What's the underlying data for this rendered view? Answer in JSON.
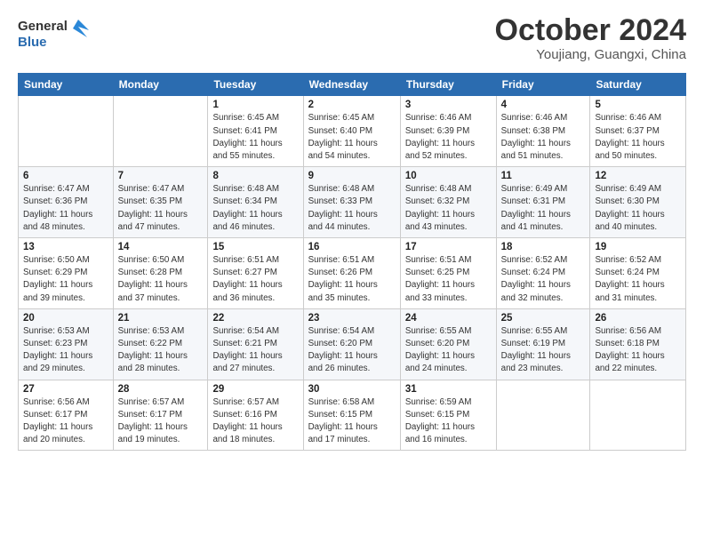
{
  "header": {
    "logo_line1": "General",
    "logo_line2": "Blue",
    "month": "October 2024",
    "location": "Youjiang, Guangxi, China"
  },
  "weekdays": [
    "Sunday",
    "Monday",
    "Tuesday",
    "Wednesday",
    "Thursday",
    "Friday",
    "Saturday"
  ],
  "weeks": [
    [
      {
        "day": "",
        "info": ""
      },
      {
        "day": "",
        "info": ""
      },
      {
        "day": "1",
        "info": "Sunrise: 6:45 AM\nSunset: 6:41 PM\nDaylight: 11 hours\nand 55 minutes."
      },
      {
        "day": "2",
        "info": "Sunrise: 6:45 AM\nSunset: 6:40 PM\nDaylight: 11 hours\nand 54 minutes."
      },
      {
        "day": "3",
        "info": "Sunrise: 6:46 AM\nSunset: 6:39 PM\nDaylight: 11 hours\nand 52 minutes."
      },
      {
        "day": "4",
        "info": "Sunrise: 6:46 AM\nSunset: 6:38 PM\nDaylight: 11 hours\nand 51 minutes."
      },
      {
        "day": "5",
        "info": "Sunrise: 6:46 AM\nSunset: 6:37 PM\nDaylight: 11 hours\nand 50 minutes."
      }
    ],
    [
      {
        "day": "6",
        "info": "Sunrise: 6:47 AM\nSunset: 6:36 PM\nDaylight: 11 hours\nand 48 minutes."
      },
      {
        "day": "7",
        "info": "Sunrise: 6:47 AM\nSunset: 6:35 PM\nDaylight: 11 hours\nand 47 minutes."
      },
      {
        "day": "8",
        "info": "Sunrise: 6:48 AM\nSunset: 6:34 PM\nDaylight: 11 hours\nand 46 minutes."
      },
      {
        "day": "9",
        "info": "Sunrise: 6:48 AM\nSunset: 6:33 PM\nDaylight: 11 hours\nand 44 minutes."
      },
      {
        "day": "10",
        "info": "Sunrise: 6:48 AM\nSunset: 6:32 PM\nDaylight: 11 hours\nand 43 minutes."
      },
      {
        "day": "11",
        "info": "Sunrise: 6:49 AM\nSunset: 6:31 PM\nDaylight: 11 hours\nand 41 minutes."
      },
      {
        "day": "12",
        "info": "Sunrise: 6:49 AM\nSunset: 6:30 PM\nDaylight: 11 hours\nand 40 minutes."
      }
    ],
    [
      {
        "day": "13",
        "info": "Sunrise: 6:50 AM\nSunset: 6:29 PM\nDaylight: 11 hours\nand 39 minutes."
      },
      {
        "day": "14",
        "info": "Sunrise: 6:50 AM\nSunset: 6:28 PM\nDaylight: 11 hours\nand 37 minutes."
      },
      {
        "day": "15",
        "info": "Sunrise: 6:51 AM\nSunset: 6:27 PM\nDaylight: 11 hours\nand 36 minutes."
      },
      {
        "day": "16",
        "info": "Sunrise: 6:51 AM\nSunset: 6:26 PM\nDaylight: 11 hours\nand 35 minutes."
      },
      {
        "day": "17",
        "info": "Sunrise: 6:51 AM\nSunset: 6:25 PM\nDaylight: 11 hours\nand 33 minutes."
      },
      {
        "day": "18",
        "info": "Sunrise: 6:52 AM\nSunset: 6:24 PM\nDaylight: 11 hours\nand 32 minutes."
      },
      {
        "day": "19",
        "info": "Sunrise: 6:52 AM\nSunset: 6:24 PM\nDaylight: 11 hours\nand 31 minutes."
      }
    ],
    [
      {
        "day": "20",
        "info": "Sunrise: 6:53 AM\nSunset: 6:23 PM\nDaylight: 11 hours\nand 29 minutes."
      },
      {
        "day": "21",
        "info": "Sunrise: 6:53 AM\nSunset: 6:22 PM\nDaylight: 11 hours\nand 28 minutes."
      },
      {
        "day": "22",
        "info": "Sunrise: 6:54 AM\nSunset: 6:21 PM\nDaylight: 11 hours\nand 27 minutes."
      },
      {
        "day": "23",
        "info": "Sunrise: 6:54 AM\nSunset: 6:20 PM\nDaylight: 11 hours\nand 26 minutes."
      },
      {
        "day": "24",
        "info": "Sunrise: 6:55 AM\nSunset: 6:20 PM\nDaylight: 11 hours\nand 24 minutes."
      },
      {
        "day": "25",
        "info": "Sunrise: 6:55 AM\nSunset: 6:19 PM\nDaylight: 11 hours\nand 23 minutes."
      },
      {
        "day": "26",
        "info": "Sunrise: 6:56 AM\nSunset: 6:18 PM\nDaylight: 11 hours\nand 22 minutes."
      }
    ],
    [
      {
        "day": "27",
        "info": "Sunrise: 6:56 AM\nSunset: 6:17 PM\nDaylight: 11 hours\nand 20 minutes."
      },
      {
        "day": "28",
        "info": "Sunrise: 6:57 AM\nSunset: 6:17 PM\nDaylight: 11 hours\nand 19 minutes."
      },
      {
        "day": "29",
        "info": "Sunrise: 6:57 AM\nSunset: 6:16 PM\nDaylight: 11 hours\nand 18 minutes."
      },
      {
        "day": "30",
        "info": "Sunrise: 6:58 AM\nSunset: 6:15 PM\nDaylight: 11 hours\nand 17 minutes."
      },
      {
        "day": "31",
        "info": "Sunrise: 6:59 AM\nSunset: 6:15 PM\nDaylight: 11 hours\nand 16 minutes."
      },
      {
        "day": "",
        "info": ""
      },
      {
        "day": "",
        "info": ""
      }
    ]
  ]
}
